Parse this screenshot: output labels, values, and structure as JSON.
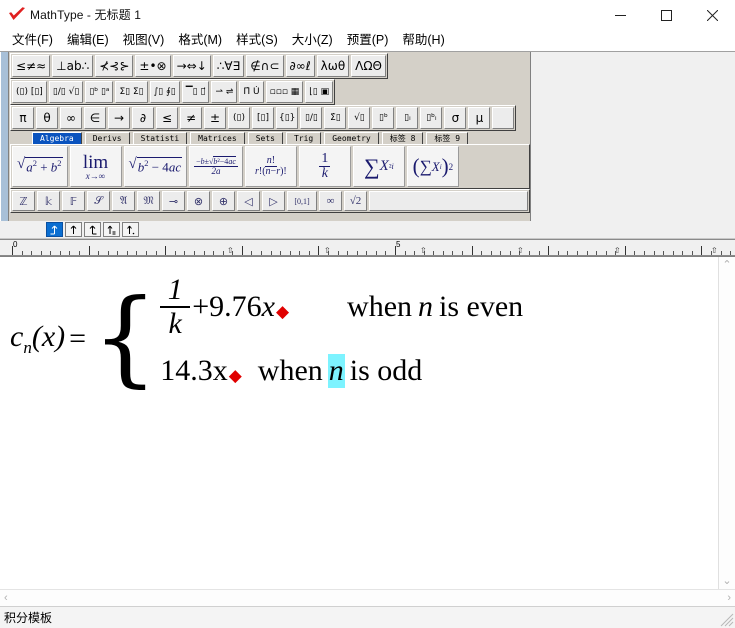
{
  "window": {
    "title": "MathType - 无标题 1",
    "logo_icon": "mathtype-check-logo",
    "minimize_label": "—",
    "maximize_label": "□",
    "close_label": "✕"
  },
  "menubar": {
    "items": [
      {
        "label": "文件(F)",
        "name": "menu-file"
      },
      {
        "label": "编辑(E)",
        "name": "menu-edit"
      },
      {
        "label": "视图(V)",
        "name": "menu-view"
      },
      {
        "label": "格式(M)",
        "name": "menu-format"
      },
      {
        "label": "样式(S)",
        "name": "menu-style"
      },
      {
        "label": "大小(Z)",
        "name": "menu-size"
      },
      {
        "label": "预置(P)",
        "name": "menu-preferences"
      },
      {
        "label": "帮助(H)",
        "name": "menu-help"
      }
    ]
  },
  "toolbar": {
    "small_bar_row1": [
      {
        "label": "≤≠≈",
        "name": "relations-palette"
      },
      {
        "label": "⊥ab∴",
        "name": "spaces-and-dots-palette"
      },
      {
        "label": "⊀⊰⊱",
        "name": "embellishments-palette"
      },
      {
        "label": "±•⊗",
        "name": "operators-palette"
      },
      {
        "label": "→⇔↓",
        "name": "arrows-palette"
      },
      {
        "label": "∴∀∃",
        "name": "logical-palette"
      },
      {
        "label": "∉∩⊂",
        "name": "set-theory-palette"
      },
      {
        "label": "∂∞ℓ",
        "name": "miscellaneous-palette"
      },
      {
        "label": "λωθ",
        "name": "greek-lowercase-palette"
      },
      {
        "label": "ΛΩΘ",
        "name": "greek-uppercase-palette"
      }
    ],
    "small_bar_row2": [
      {
        "label": "(▯) [▯]",
        "name": "fences-template-palette"
      },
      {
        "label": "▯/▯ √▯",
        "name": "fraction-radical-template-palette"
      },
      {
        "label": "▯ᵇ ▯ᵃ",
        "name": "subscript-superscript-template-palette"
      },
      {
        "label": "Σ▯ Σ▯",
        "name": "summation-template-palette"
      },
      {
        "label": "∫▯ ∮▯",
        "name": "integral-template-palette"
      },
      {
        "label": "▔▯ ▯⃗",
        "name": "underbar-overbar-template-palette"
      },
      {
        "label": "⇀ ⇌",
        "name": "labeled-arrow-template-palette"
      },
      {
        "label": "Π̇ U̇",
        "name": "product-set-theory-template-palette"
      },
      {
        "label": "▫▫▫ ▦",
        "name": "matrix-template-palette"
      },
      {
        "label": "⌊▯ ▣",
        "name": "matrix-layout-template-palette"
      }
    ],
    "symbol_row": [
      {
        "label": "π",
        "name": "symbol-pi"
      },
      {
        "label": "θ",
        "name": "symbol-theta"
      },
      {
        "label": "∞",
        "name": "symbol-infinity"
      },
      {
        "label": "∈",
        "name": "symbol-element-of"
      },
      {
        "label": "→",
        "name": "symbol-right-arrow"
      },
      {
        "label": "∂",
        "name": "symbol-partial"
      },
      {
        "label": "≤",
        "name": "symbol-less-equal"
      },
      {
        "label": "≠",
        "name": "symbol-not-equal"
      },
      {
        "label": "±",
        "name": "symbol-plus-minus"
      },
      {
        "label": "(▯)",
        "name": "template-parentheses"
      },
      {
        "label": "[▯]",
        "name": "template-brackets"
      },
      {
        "label": "{▯}",
        "name": "template-braces"
      },
      {
        "label": "▯/▯",
        "name": "template-fraction"
      },
      {
        "label": "Σ̇▯",
        "name": "template-summation"
      },
      {
        "label": "√▯",
        "name": "template-radical"
      },
      {
        "label": "▯ᵇ",
        "name": "template-superscript"
      },
      {
        "label": "▯ᵢ",
        "name": "template-subscript"
      },
      {
        "label": "▯ᵇᵢ",
        "name": "template-subsuperscript"
      },
      {
        "label": "σ",
        "name": "symbol-sigma"
      },
      {
        "label": "μ",
        "name": "symbol-mu"
      },
      {
        "label": "",
        "name": "symbol-blank"
      }
    ],
    "palette_tabs": [
      {
        "label": "Algebra",
        "name": "palette-tab-algebra",
        "active": true
      },
      {
        "label": "Derivs",
        "name": "palette-tab-derivs",
        "active": false
      },
      {
        "label": "Statisti",
        "name": "palette-tab-statistics",
        "active": false
      },
      {
        "label": "Matrices",
        "name": "palette-tab-matrices",
        "active": false
      },
      {
        "label": "Sets",
        "name": "palette-tab-sets",
        "active": false
      },
      {
        "label": "Trig",
        "name": "palette-tab-trig",
        "active": false
      },
      {
        "label": "Geometry",
        "name": "palette-tab-geometry",
        "active": false
      },
      {
        "label": "标签 8",
        "name": "palette-tab-8",
        "active": false
      },
      {
        "label": "标签 9",
        "name": "palette-tab-9",
        "active": false
      }
    ],
    "templates": [
      {
        "name": "template-sqrt-a2-b2",
        "desc": "√(a²+b²)"
      },
      {
        "name": "template-limit",
        "desc": "lim x→∞"
      },
      {
        "name": "template-sqrt-b2-4ac",
        "desc": "√(b²−4ac)"
      },
      {
        "name": "template-quadratic-formula",
        "desc": "(−b±√(b²−4ac))/2a"
      },
      {
        "name": "template-combination",
        "desc": "n!/(r!(n−r)!)"
      },
      {
        "name": "template-one-over-k",
        "desc": "1/k"
      },
      {
        "name": "template-sum-x-squared",
        "desc": "Σ Xᵢ²"
      },
      {
        "name": "template-sum-squared",
        "desc": "(Σ Xᵢ)²"
      }
    ],
    "script_row": [
      {
        "label": "ℤ",
        "name": "symbol-double-struck-z"
      },
      {
        "label": "𝕜",
        "name": "symbol-fraktur-k"
      },
      {
        "label": "𝔽",
        "name": "symbol-double-struck-f"
      },
      {
        "label": "𝒮",
        "name": "symbol-script-s"
      },
      {
        "label": "𝔄",
        "name": "symbol-fraktur-a"
      },
      {
        "label": "𝔐",
        "name": "symbol-fraktur-m"
      },
      {
        "label": "⊸",
        "name": "symbol-multimap"
      },
      {
        "label": "⊗",
        "name": "symbol-circled-times"
      },
      {
        "label": "⊕",
        "name": "symbol-circled-plus"
      },
      {
        "label": "◁",
        "name": "symbol-left-triangle"
      },
      {
        "label": "▷",
        "name": "symbol-right-triangle"
      },
      {
        "label": "[0,1]",
        "name": "symbol-unit-interval"
      },
      {
        "label": "∞",
        "name": "symbol-infinity-2"
      },
      {
        "label": "√2",
        "name": "symbol-sqrt-two"
      }
    ],
    "tabstops": [
      {
        "label": "⇥",
        "name": "tabstop-left",
        "active": true
      },
      {
        "label": "↑",
        "name": "tabstop-center",
        "active": false
      },
      {
        "label": "⇧",
        "name": "tabstop-right",
        "active": false
      },
      {
        "label": "⇪",
        "name": "tabstop-decimal",
        "active": false
      },
      {
        "label": "⇮",
        "name": "tabstop-relation",
        "active": false
      }
    ]
  },
  "ruler": {
    "labels": [
      "0",
      "5"
    ],
    "label_positions": [
      12,
      395
    ]
  },
  "document": {
    "formula": {
      "lhs": "c",
      "lhs_sub": "n",
      "lhs_arg": "(x)",
      "equals": "=",
      "brace": "{",
      "case1": {
        "fraction_numerator": "1",
        "fraction_denominator": "k",
        "expression": "+9.76",
        "variable": "x",
        "tab_marker": "◆",
        "condition_pre": "when",
        "condition_var": "n",
        "condition_post": "is even"
      },
      "case2": {
        "expression": "14.3x",
        "tab_marker": "◆",
        "condition_pre": "when",
        "condition_var": "n",
        "condition_post": "is odd",
        "selection_color": "#7df3ff"
      }
    }
  },
  "scrollbars": {
    "vertical_up": "⌃",
    "vertical_down": "⌄",
    "horizontal_left": "‹",
    "horizontal_right": "›"
  },
  "statusbar": {
    "text": "积分模板"
  },
  "colors": {
    "accent": "#0a53be",
    "selection": "#7df3ff",
    "tab_marker": "#e00000",
    "logo": "#e02020",
    "toolbar_bg": "#d4d0c8"
  }
}
